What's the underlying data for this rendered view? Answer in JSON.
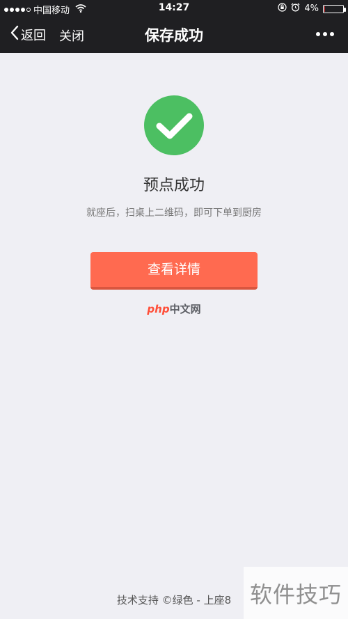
{
  "status_bar": {
    "carrier": "中国移动",
    "time": "14:27",
    "battery_percent": "4%",
    "battery_level": 0.04,
    "icons": [
      "signal-dots-icon",
      "wifi-icon",
      "rotation-lock-icon",
      "alarm-icon",
      "battery-icon"
    ]
  },
  "nav": {
    "back_label": "返回",
    "close_label": "关闭",
    "title": "保存成功",
    "more_icon": "more-dots-icon"
  },
  "content": {
    "status_icon": "check-circle-icon",
    "heading": "预点成功",
    "message": "就座后，扫桌上二维码，即可下单到厨房",
    "button_label": "查看详情",
    "logo_php": "php",
    "logo_cn": "中文网"
  },
  "footer": {
    "text": "技术支持 ©绿色 - 上座8"
  },
  "watermark": {
    "text": "软件技巧"
  },
  "colors": {
    "topbar": "#1f1f22",
    "background": "#efeff4",
    "success_green": "#4cbf62",
    "button_orange": "#ff6a50"
  }
}
